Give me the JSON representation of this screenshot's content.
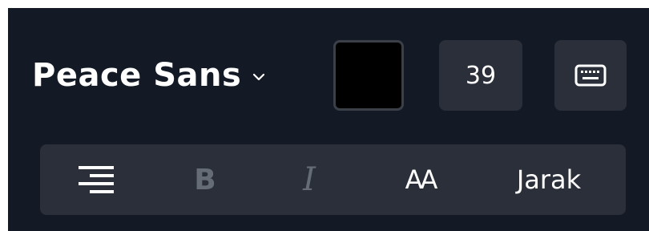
{
  "font_picker": {
    "font_name": "Peace Sans",
    "icon": "chevron-down-icon"
  },
  "color_swatch": {
    "color": "#000000"
  },
  "font_size": {
    "value": "39"
  },
  "keyboard_button": {
    "icon": "keyboard-icon"
  },
  "format_toolbar": {
    "align": {
      "icon": "align-right-icon"
    },
    "bold": {
      "label": "B",
      "state": "disabled"
    },
    "italic": {
      "label": "I",
      "state": "disabled"
    },
    "caps": {
      "label": "AA"
    },
    "spacing": {
      "label": "Jarak"
    }
  },
  "colors": {
    "background": "#141a25",
    "control": "#2a2f39",
    "text": "#ffffff",
    "muted": "#666c75"
  }
}
